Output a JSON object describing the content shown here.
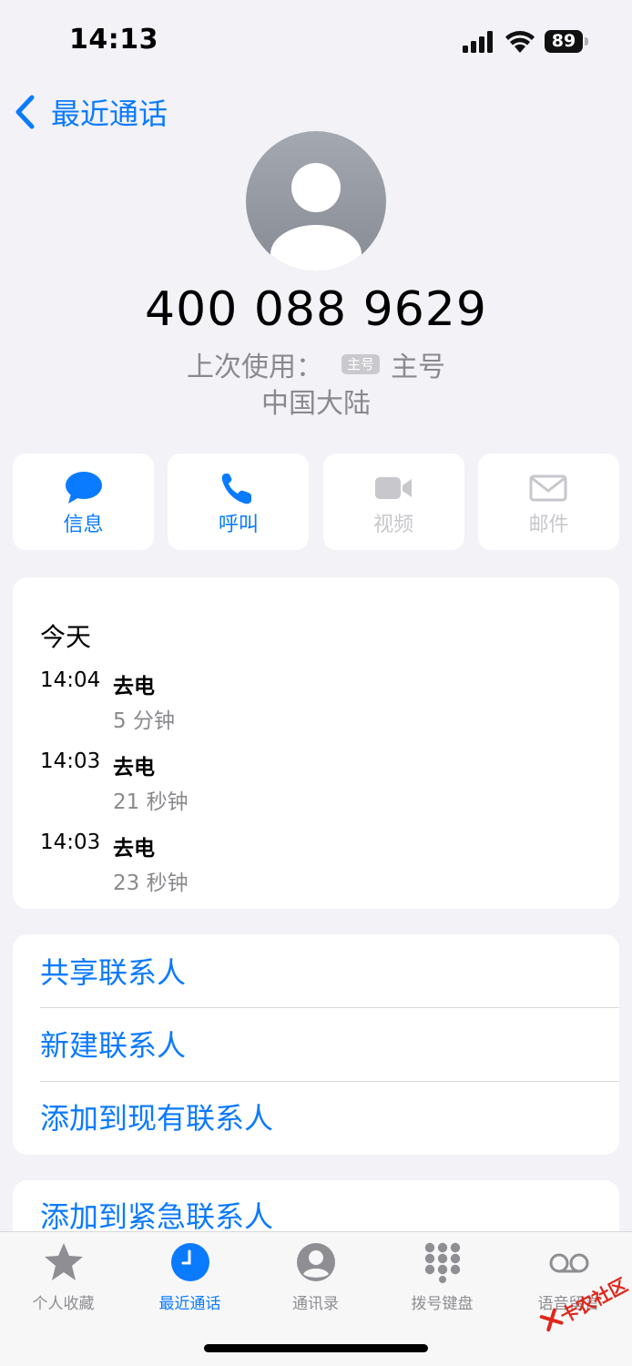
{
  "status_bar": {
    "time": "14:13",
    "battery": "89",
    "icons": [
      "cellular-signal-icon",
      "wifi-icon",
      "battery-icon"
    ]
  },
  "nav": {
    "back_label": "最近通话",
    "back_icon": "chevron-left-icon"
  },
  "contact": {
    "avatar_icon": "person-icon",
    "phone_number": "400 088 9629",
    "last_used_label": "上次使用：",
    "sim_badge": "主号",
    "sim_name": "主号",
    "region": "中国大陆"
  },
  "actions": [
    {
      "label": "信息",
      "icon": "message-bubble-icon",
      "enabled": true
    },
    {
      "label": "呼叫",
      "icon": "phone-icon",
      "enabled": true
    },
    {
      "label": "视频",
      "icon": "video-camera-icon",
      "enabled": false
    },
    {
      "label": "邮件",
      "icon": "envelope-icon",
      "enabled": false
    }
  ],
  "history": {
    "date_label": "今天",
    "calls": [
      {
        "time": "14:04",
        "type": "去电",
        "duration": "5 分钟"
      },
      {
        "time": "14:03",
        "type": "去电",
        "duration": "21 秒钟"
      },
      {
        "time": "14:03",
        "type": "去电",
        "duration": "23 秒钟"
      }
    ]
  },
  "options": [
    {
      "label": "共享联系人"
    },
    {
      "label": "新建联系人"
    },
    {
      "label": "添加到现有联系人"
    }
  ],
  "options2": [
    {
      "label": "添加到紧急联系人"
    }
  ],
  "tab_bar": {
    "tabs": [
      {
        "label": "个人收藏",
        "icon": "star-icon"
      },
      {
        "label": "最近通话",
        "icon": "clock-icon",
        "active": true
      },
      {
        "label": "通讯录",
        "icon": "person-circle-icon"
      },
      {
        "label": "拨号键盘",
        "icon": "keypad-icon"
      },
      {
        "label": "语音留言",
        "icon": "voicemail-icon"
      }
    ]
  },
  "watermark": {
    "text": "卡农社区"
  },
  "colors": {
    "accent": "#0a7aff",
    "background": "#f2f2f7",
    "disabled": "#c7c7cc",
    "secondary": "#8a8a8e"
  }
}
